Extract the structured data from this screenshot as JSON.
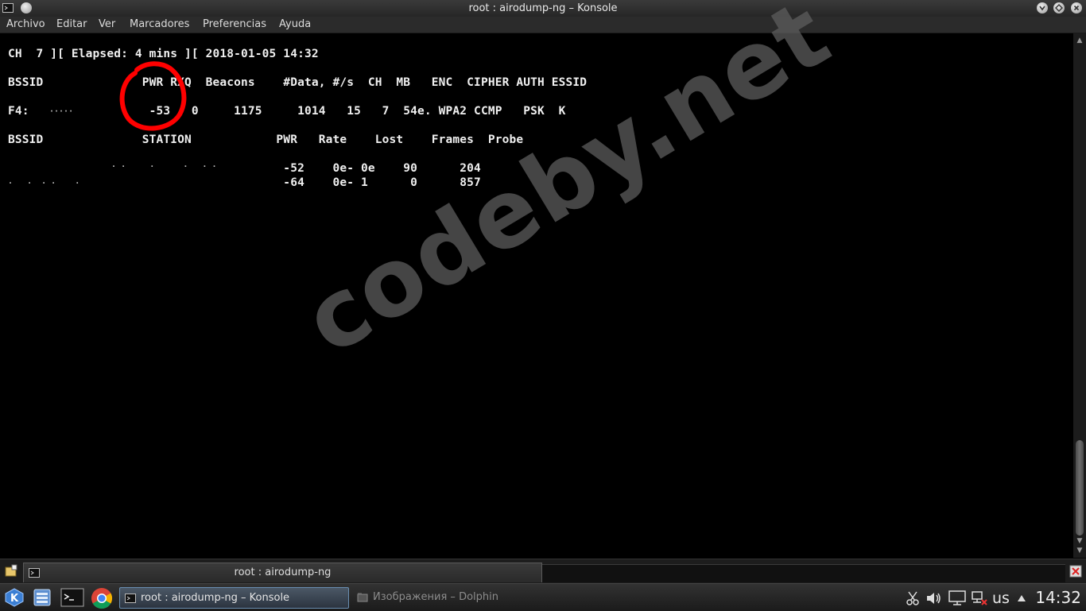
{
  "window": {
    "title": "root : airodump-ng – Konsole"
  },
  "menu": {
    "items": [
      "Archivo",
      "Editar",
      "Ver",
      "Marcadores",
      "Preferencias",
      "Ayuda"
    ]
  },
  "terminal": {
    "status_line": "CH  7 ][ Elapsed: 4 mins ][ 2018-01-05 14:32",
    "ap_header": "BSSID              PWR RXQ  Beacons    #Data, #/s  CH  MB   ENC  CIPHER AUTH ESSID",
    "ap_row": "F4:                 -53   0     1175     1014   15   7  54e. WPA2 CCMP   PSK  K",
    "station_header": "BSSID              STATION            PWR   Rate    Lost    Frames  Probe",
    "station_row_1": "                                       -52    0e- 0e    90      204",
    "station_row_2": "                                       -64    0e- 1      0      857",
    "annotation_color": "#ff0000"
  },
  "tabbar": {
    "active_tab": "root : airodump-ng"
  },
  "taskbar": {
    "tasks": [
      {
        "label": "root : airodump-ng – Konsole",
        "active": true
      },
      {
        "label": "Изображения – Dolphin",
        "active": false
      }
    ],
    "keyboard_layout": "us",
    "clock": "14:32"
  },
  "watermark": {
    "text": "codeby.net"
  }
}
